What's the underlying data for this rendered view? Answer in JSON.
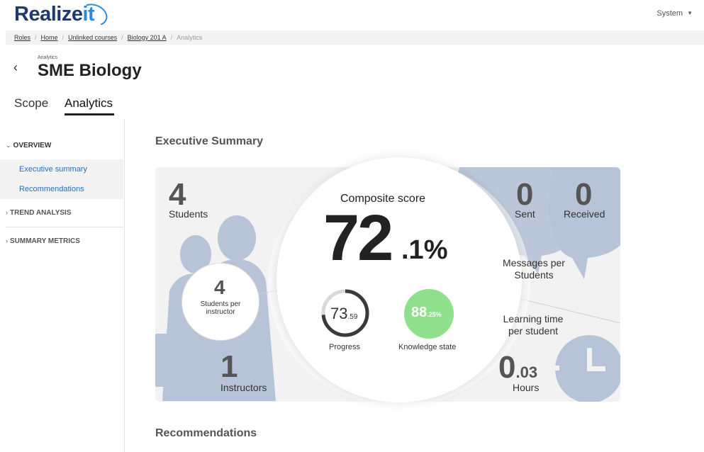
{
  "header": {
    "logo_main": "Realize",
    "logo_accent": "it",
    "user_menu": "System"
  },
  "breadcrumb": [
    "Roles",
    "Home",
    "Unlinked courses",
    "Biology 201 A",
    "Analytics"
  ],
  "page": {
    "eyebrow": "Analytics",
    "title": "SME Biology"
  },
  "tabs": [
    {
      "label": "Scope",
      "active": false
    },
    {
      "label": "Analytics",
      "active": true
    }
  ],
  "sidebar": {
    "overview": "OVERVIEW",
    "items": [
      "Executive summary",
      "Recommendations"
    ],
    "trend": "TREND ANALYSIS",
    "metrics": "SUMMARY METRICS"
  },
  "main": {
    "executive_title": "Executive Summary",
    "recommendations_title": "Recommendations",
    "students": {
      "value": "4",
      "label": "Students"
    },
    "students_per_instructor": {
      "value": "4",
      "label": "Students per instructor"
    },
    "instructors": {
      "value": "1",
      "label": "Instructors"
    },
    "composite": {
      "label": "Composite score",
      "whole": "72",
      "decimal": ".1%",
      "percent": 72.1
    },
    "progress": {
      "whole": "73",
      "decimal": ".59",
      "label": "Progress",
      "percent": 73.59
    },
    "knowledge": {
      "whole": "88",
      "decimal": ".25%",
      "label": "Knowledge state",
      "percent": 88.25
    },
    "sent": {
      "value": "0",
      "label": "Sent"
    },
    "received": {
      "value": "0",
      "label": "Received"
    },
    "messages_label": "Messages per Students",
    "learning_label": "Learning time per student",
    "hours": {
      "whole": "0",
      "decimal": ".03",
      "label": "Hours"
    }
  },
  "colors": {
    "accent_blue": "#2a6fb8",
    "knowledge_green": "#8ee08c",
    "silhouette": "#b7c3d6"
  }
}
